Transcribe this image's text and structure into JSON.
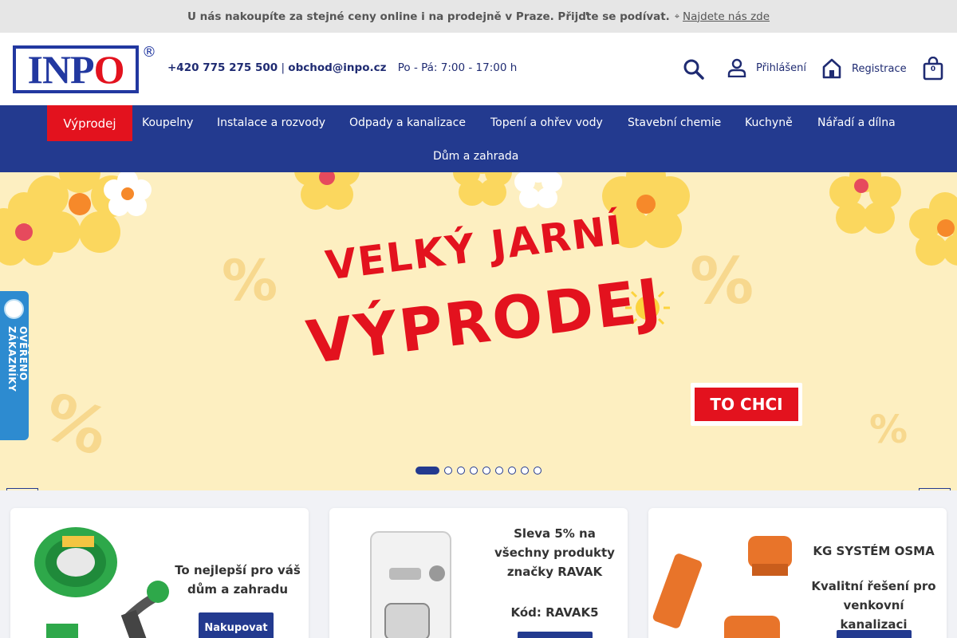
{
  "topbar": {
    "text": "U nás nakoupíte za stejné ceny online i na prodejně v Praze. Přijďte se podívat.",
    "link": "Najdete nás zde"
  },
  "header": {
    "logo_text_in": "INP",
    "logo_text_o": "O",
    "registered": "®",
    "phone": "+420 775 275 500",
    "separator": "|",
    "email": "obchod@inpo.cz",
    "hours": "Po - Pá: 7:00 - 17:00 h",
    "login_label": "Přihlášení",
    "register_label": "Registrace",
    "cart_count": "0"
  },
  "nav": {
    "items": [
      {
        "label": "Výprodej"
      },
      {
        "label": "Koupelny"
      },
      {
        "label": "Instalace a rozvody"
      },
      {
        "label": "Odpady a kanalizace"
      },
      {
        "label": "Topení a ohřev vody"
      },
      {
        "label": "Stavební chemie"
      },
      {
        "label": "Kuchyně"
      },
      {
        "label": "Nářadí a dílna"
      },
      {
        "label": "Dům a zahrada"
      }
    ]
  },
  "hero": {
    "title_line1": "VELKÝ JARNÍ",
    "title_line2": "VÝPRODEJ",
    "cta": "TO CHCI",
    "slides_total": 10,
    "active_slide": 1,
    "colors": {
      "background": "#fdefc1",
      "accent": "#e3121e",
      "flower": "#fbd75e"
    }
  },
  "verified_badge": {
    "text": "OVĚŘENO ZÁKAZNÍKY"
  },
  "cards": [
    {
      "text": "To nejlepší pro váš dům a zahradu",
      "button": "Nakupovat"
    },
    {
      "text_lines": [
        "Sleva 5% na",
        "všechny produkty",
        "značky RAVAK"
      ],
      "code": "Kód: RAVAK5",
      "button": ""
    },
    {
      "title": "KG SYSTÉM OSMA",
      "text": "Kvalitní řešení pro venkovní kanalizaci",
      "button": ""
    }
  ],
  "colors": {
    "brand_blue": "#233a8f",
    "brand_red": "#e3121e"
  }
}
